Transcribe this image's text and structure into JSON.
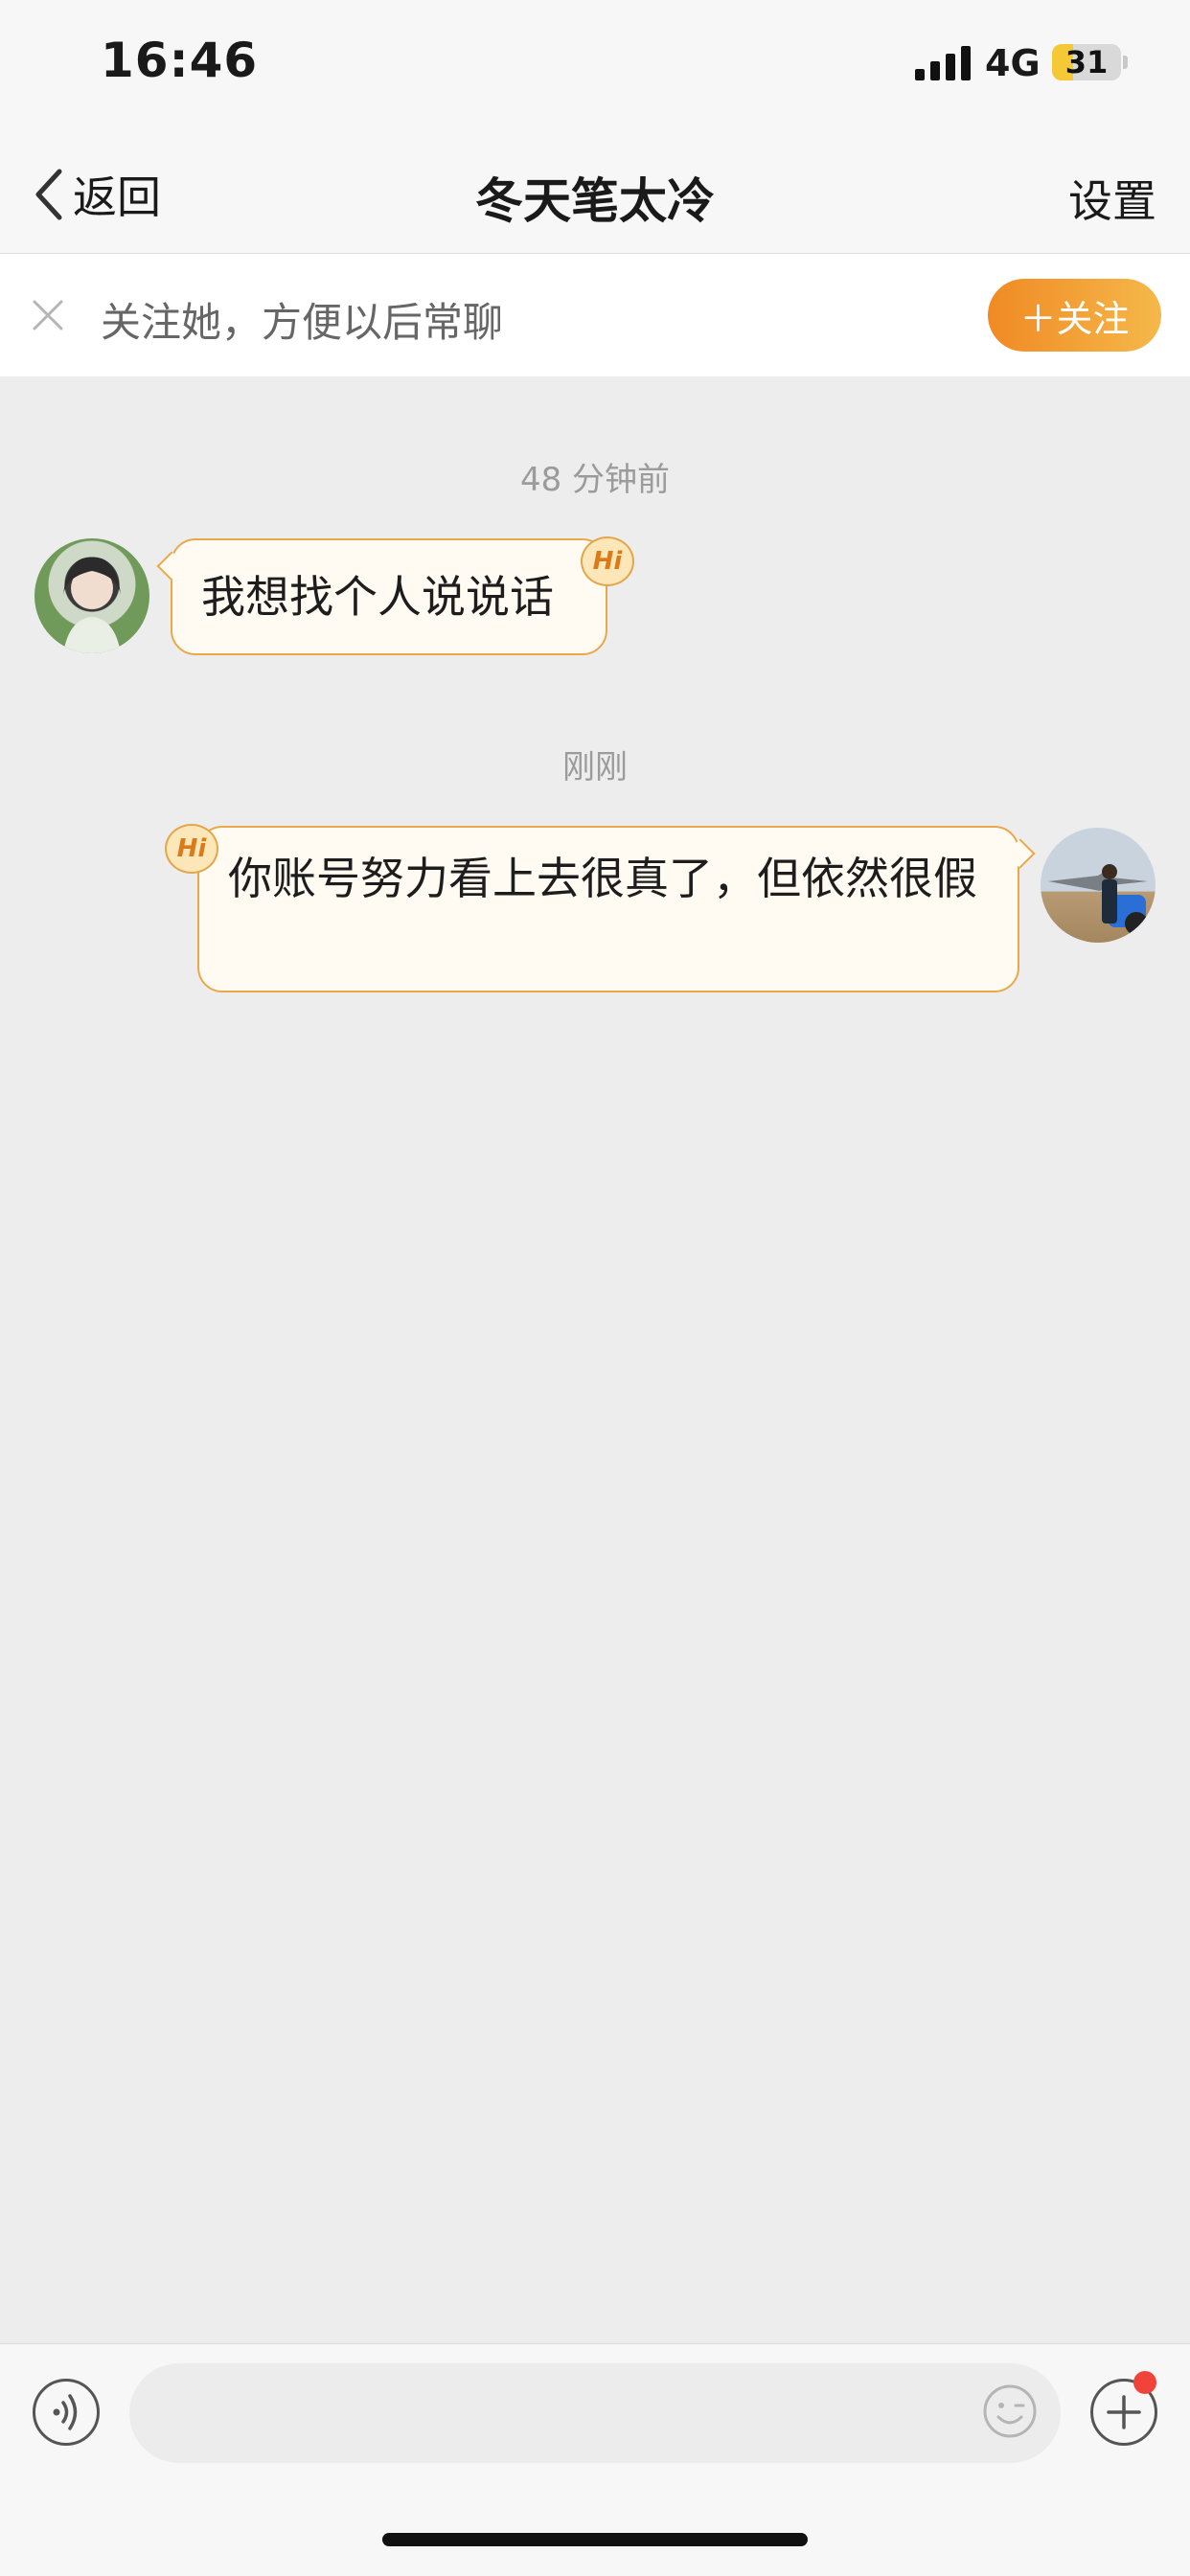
{
  "status_bar": {
    "time": "16:46",
    "network": "4G",
    "battery_percent": "31",
    "battery_level": 0.31
  },
  "nav": {
    "back_label": "返回",
    "title": "冬天笔太冷",
    "settings_label": "设置"
  },
  "follow_banner": {
    "text": "关注她，方便以后常聊",
    "button_label": "＋关注"
  },
  "messages": [
    {
      "timestamp": "48 分钟前",
      "sender": "other",
      "text": "我想找个人说说话",
      "badge": "Hi"
    },
    {
      "timestamp": "刚刚",
      "sender": "self",
      "text": "你账号努力看上去很真了，但依然很假",
      "badge": "Hi"
    }
  ],
  "input": {
    "placeholder": ""
  },
  "icons": {
    "back": "chevron-left-icon",
    "close": "close-icon",
    "voice": "voice-icon",
    "emoji": "emoji-icon",
    "plus": "plus-icon"
  },
  "colors": {
    "accent": "#f08a24",
    "bubble_bg": "#fffbf2",
    "bubble_border": "#e9a84a",
    "notification": "#f0443a"
  }
}
